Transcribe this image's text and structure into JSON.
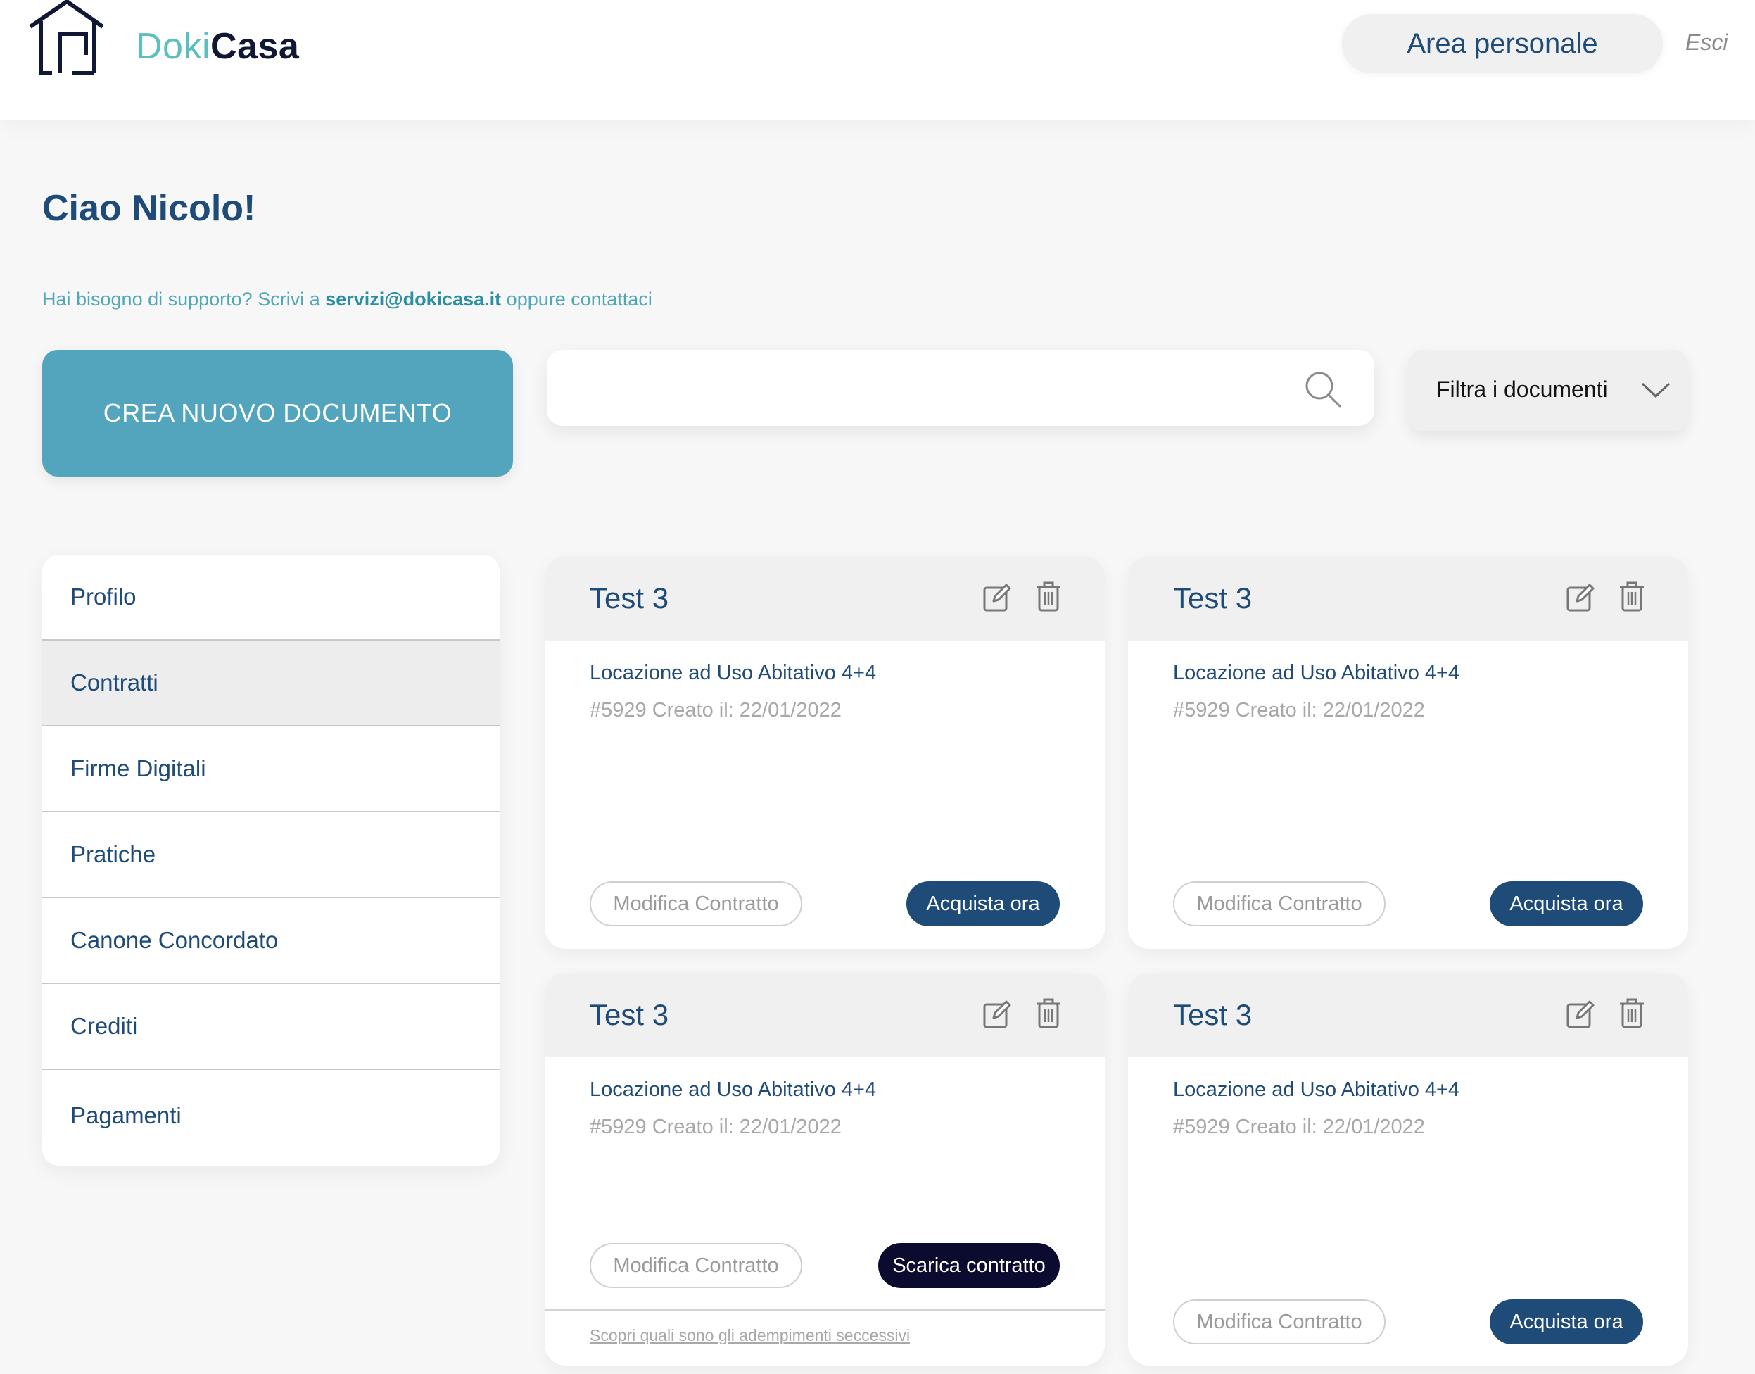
{
  "header": {
    "logo_doki": "Doki",
    "logo_casa": "Casa",
    "area_personale": "Area personale",
    "esci": "Esci"
  },
  "greeting": "Ciao Nicolo!",
  "support": {
    "prefix": "Hai bisogno di supporto? Scrivi a ",
    "email": "servizi@dokicasa.it",
    "suffix": " oppure contattaci"
  },
  "actions": {
    "create_label": "CREA NUOVO DOCUMENTO",
    "search_placeholder": "",
    "filter_label": "Filtra i documenti"
  },
  "sidebar": {
    "items": [
      {
        "label": "Profilo"
      },
      {
        "label": "Contratti"
      },
      {
        "label": "Firme Digitali"
      },
      {
        "label": "Pratiche"
      },
      {
        "label": "Canone Concordato"
      },
      {
        "label": "Crediti"
      },
      {
        "label": "Pagamenti"
      }
    ],
    "active": "Contratti"
  },
  "cards": [
    {
      "title": "Test 3",
      "type": "Locazione ad Uso Abitativo 4+4",
      "meta": "#5929 Creato il: 22/01/2022",
      "modifica": "Modifica Contratto",
      "action": "Acquista ora"
    },
    {
      "title": "Test 3",
      "type": "Locazione ad Uso Abitativo 4+4",
      "meta": "#5929 Creato il: 22/01/2022",
      "modifica": "Modifica Contratto",
      "action": "Acquista ora"
    },
    {
      "title": "Test 3",
      "type": "Locazione ad Uso Abitativo 4+4",
      "meta": "#5929 Creato il: 22/01/2022",
      "modifica": "Modifica Contratto",
      "action": "Scarica contratto",
      "link": "Scopri quali sono gli adempimenti seccessivi"
    },
    {
      "title": "Test 3",
      "type": "Locazione ad Uso Abitativo 4+4",
      "meta": "#5929 Creato il: 22/01/2022",
      "modifica": "Modifica Contratto",
      "action": "Acquista ora"
    }
  ],
  "colors": {
    "primary": "#1e4b78",
    "accent": "#52a5bc",
    "logo_teal": "#5bbfc0",
    "dark_button": "#0b0b2f"
  },
  "icons": [
    "house-logo-icon",
    "search-icon",
    "chevron-down-icon",
    "edit-icon",
    "trash-icon"
  ]
}
